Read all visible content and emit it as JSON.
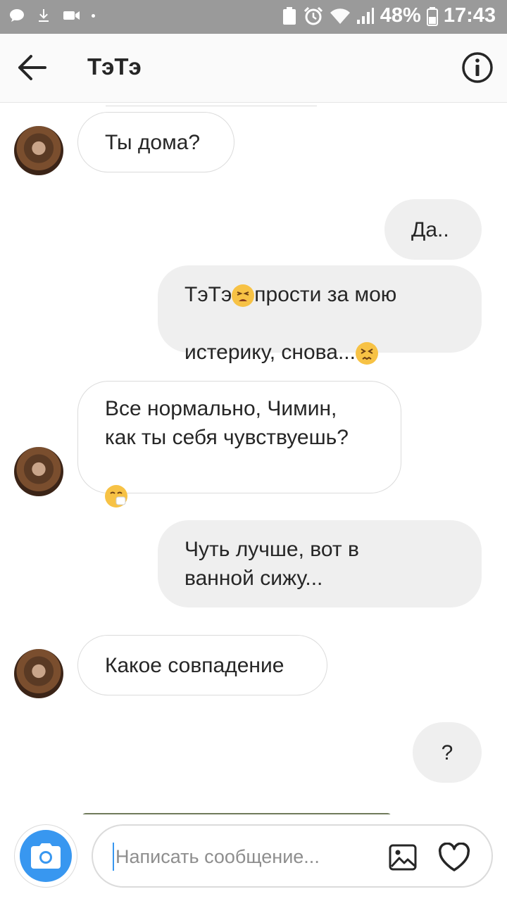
{
  "status_bar": {
    "battery": "48%",
    "time": "17:43"
  },
  "header": {
    "title": "ТэТэ"
  },
  "messages": [
    {
      "direction": "in",
      "text": "Ты дома?"
    },
    {
      "direction": "out",
      "text": "Да.."
    },
    {
      "direction": "out",
      "text_a": "ТэТэ",
      "text_b": "прости за мою",
      "text_c": "истерику, снова..."
    },
    {
      "direction": "in",
      "text": "Все нормально, Чимин,\nкак ты себя чувствуешь?"
    },
    {
      "direction": "out",
      "text": "Чуть лучше, вот в\nванной сижу..."
    },
    {
      "direction": "in",
      "text": "Какое совпадение"
    },
    {
      "direction": "out",
      "text": "?"
    }
  ],
  "composer": {
    "placeholder": "Написать сообщение..."
  },
  "colors": {
    "accent": "#3897f0",
    "status_bar": "#9a9a9a",
    "bubble_out": "#efefef",
    "bubble_border": "#dbdbdb"
  },
  "icons": {
    "back": "arrow-left-icon",
    "info": "info-circle-icon",
    "camera": "camera-icon",
    "gallery": "image-icon",
    "heart": "heart-icon"
  }
}
